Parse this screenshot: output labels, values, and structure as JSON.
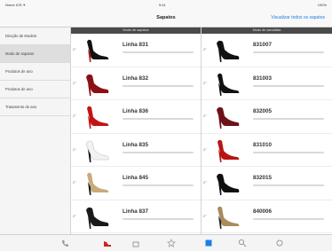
{
  "status": {
    "carrier": "Nome iOS ✈",
    "time": "9:41",
    "battery": "100%"
  },
  "nav": {
    "title": "Sapatos",
    "action_label": "Visualizar todos os sapatos"
  },
  "sidebar": {
    "items": [
      {
        "label": "Direção de Modelo",
        "active": false
      },
      {
        "label": "Modo de sapatos",
        "active": true
      },
      {
        "label": "Produtos de ano",
        "active": false
      },
      {
        "label": "Produtos de ano",
        "active": false
      },
      {
        "label": "Tratamento de ano",
        "active": false
      }
    ]
  },
  "columns": [
    {
      "header": "Modo de sapatos",
      "rows": [
        {
          "title": "Linha 831",
          "marker": "2°",
          "shoe_color": "#111111",
          "heel_color": "#b11a1a"
        },
        {
          "title": "Linha 832",
          "marker": "2°",
          "shoe_color": "#8c0f14",
          "heel_color": "#8c0f14"
        },
        {
          "title": "Linha 836",
          "marker": "2°",
          "shoe_color": "#c21414",
          "heel_color": "#c21414"
        },
        {
          "title": "Linha 835",
          "marker": "2°",
          "shoe_color": "#f2f2f2",
          "heel_color": "#111111"
        },
        {
          "title": "Linha 845",
          "marker": "2°",
          "shoe_color": "#c8ab7a",
          "heel_color": "#111111"
        },
        {
          "title": "Linha 837",
          "marker": "2°",
          "shoe_color": "#1a1a1a",
          "heel_color": "#1a1a1a"
        }
      ]
    },
    {
      "header": "Modo de sandálias",
      "rows": [
        {
          "title": "831007",
          "marker": "2°",
          "shoe_color": "#111111",
          "heel_color": "#111111"
        },
        {
          "title": "831003",
          "marker": "2°",
          "shoe_color": "#111111",
          "heel_color": "#111111"
        },
        {
          "title": "832005",
          "marker": "2°",
          "shoe_color": "#6d1218",
          "heel_color": "#6d1218"
        },
        {
          "title": "831010",
          "marker": "2°",
          "shoe_color": "#b81414",
          "heel_color": "#b81414"
        },
        {
          "title": "832015",
          "marker": "2°",
          "shoe_color": "#101010",
          "heel_color": "#101010"
        },
        {
          "title": "840006",
          "marker": "2°",
          "shoe_color": "#a88c5a",
          "heel_color": "#222222"
        }
      ]
    }
  ],
  "tabs": [
    {
      "icon": "phone-icon",
      "color": "#9a9a9a"
    },
    {
      "icon": "shoe-icon",
      "color": "#cc2222"
    },
    {
      "icon": "bag-icon",
      "color": "#9a9a9a"
    },
    {
      "icon": "star-icon",
      "color": "#9a9a9a"
    },
    {
      "icon": "catalog-icon",
      "color": "#1a7fe0"
    },
    {
      "icon": "search-icon",
      "color": "#9a9a9a"
    },
    {
      "icon": "settings-icon",
      "color": "#9a9a9a"
    }
  ]
}
